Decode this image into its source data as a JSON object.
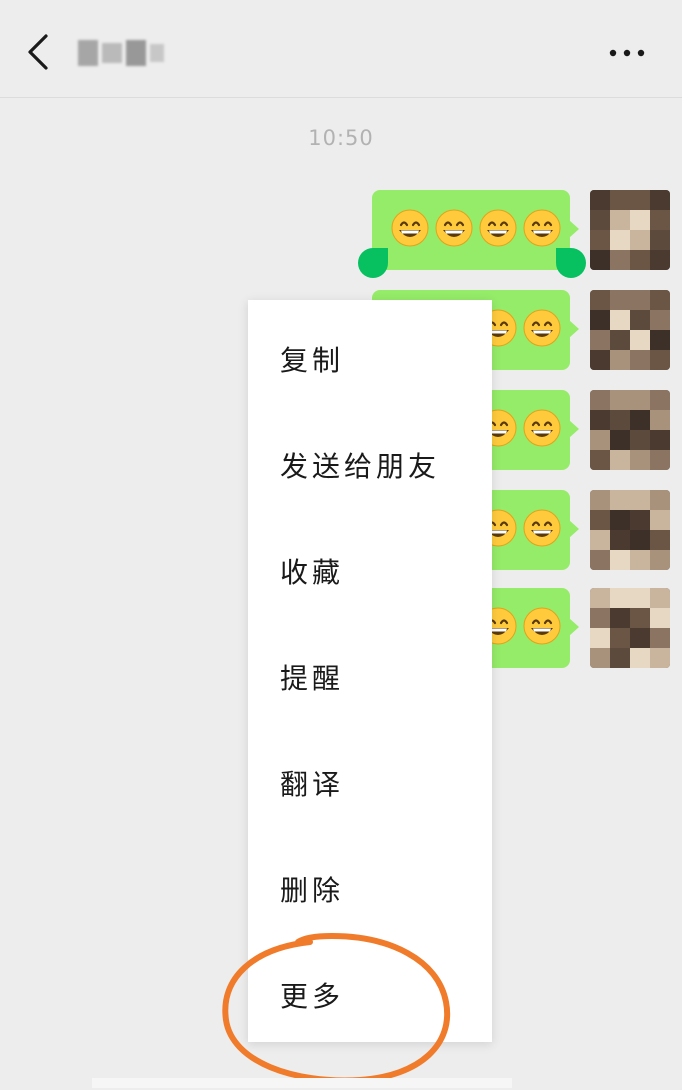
{
  "header": {
    "back_icon": "chevron-left-icon",
    "more_icon": "ellipsis-icon"
  },
  "chat": {
    "timestamp": "10:50",
    "messages": [
      {
        "emoji": "grinning-face",
        "count": 4,
        "selected": true
      },
      {
        "emoji": "grinning-face",
        "count": 4,
        "selected": false
      },
      {
        "emoji": "grinning-face",
        "count": 4,
        "selected": false
      },
      {
        "emoji": "grinning-face",
        "count": 4,
        "selected": false
      },
      {
        "emoji": "grinning-face",
        "count": 4,
        "selected": false
      }
    ]
  },
  "context_menu": {
    "items": [
      {
        "label": "复制"
      },
      {
        "label": "发送给朋友"
      },
      {
        "label": "收藏"
      },
      {
        "label": "提醒"
      },
      {
        "label": "翻译"
      },
      {
        "label": "删除"
      },
      {
        "label": "更多"
      }
    ]
  },
  "colors": {
    "background": "#ededed",
    "bubble": "#95ec69",
    "selection_handle": "#07c160",
    "menu_background": "#ffffff",
    "annotation": "#f07b2a"
  }
}
